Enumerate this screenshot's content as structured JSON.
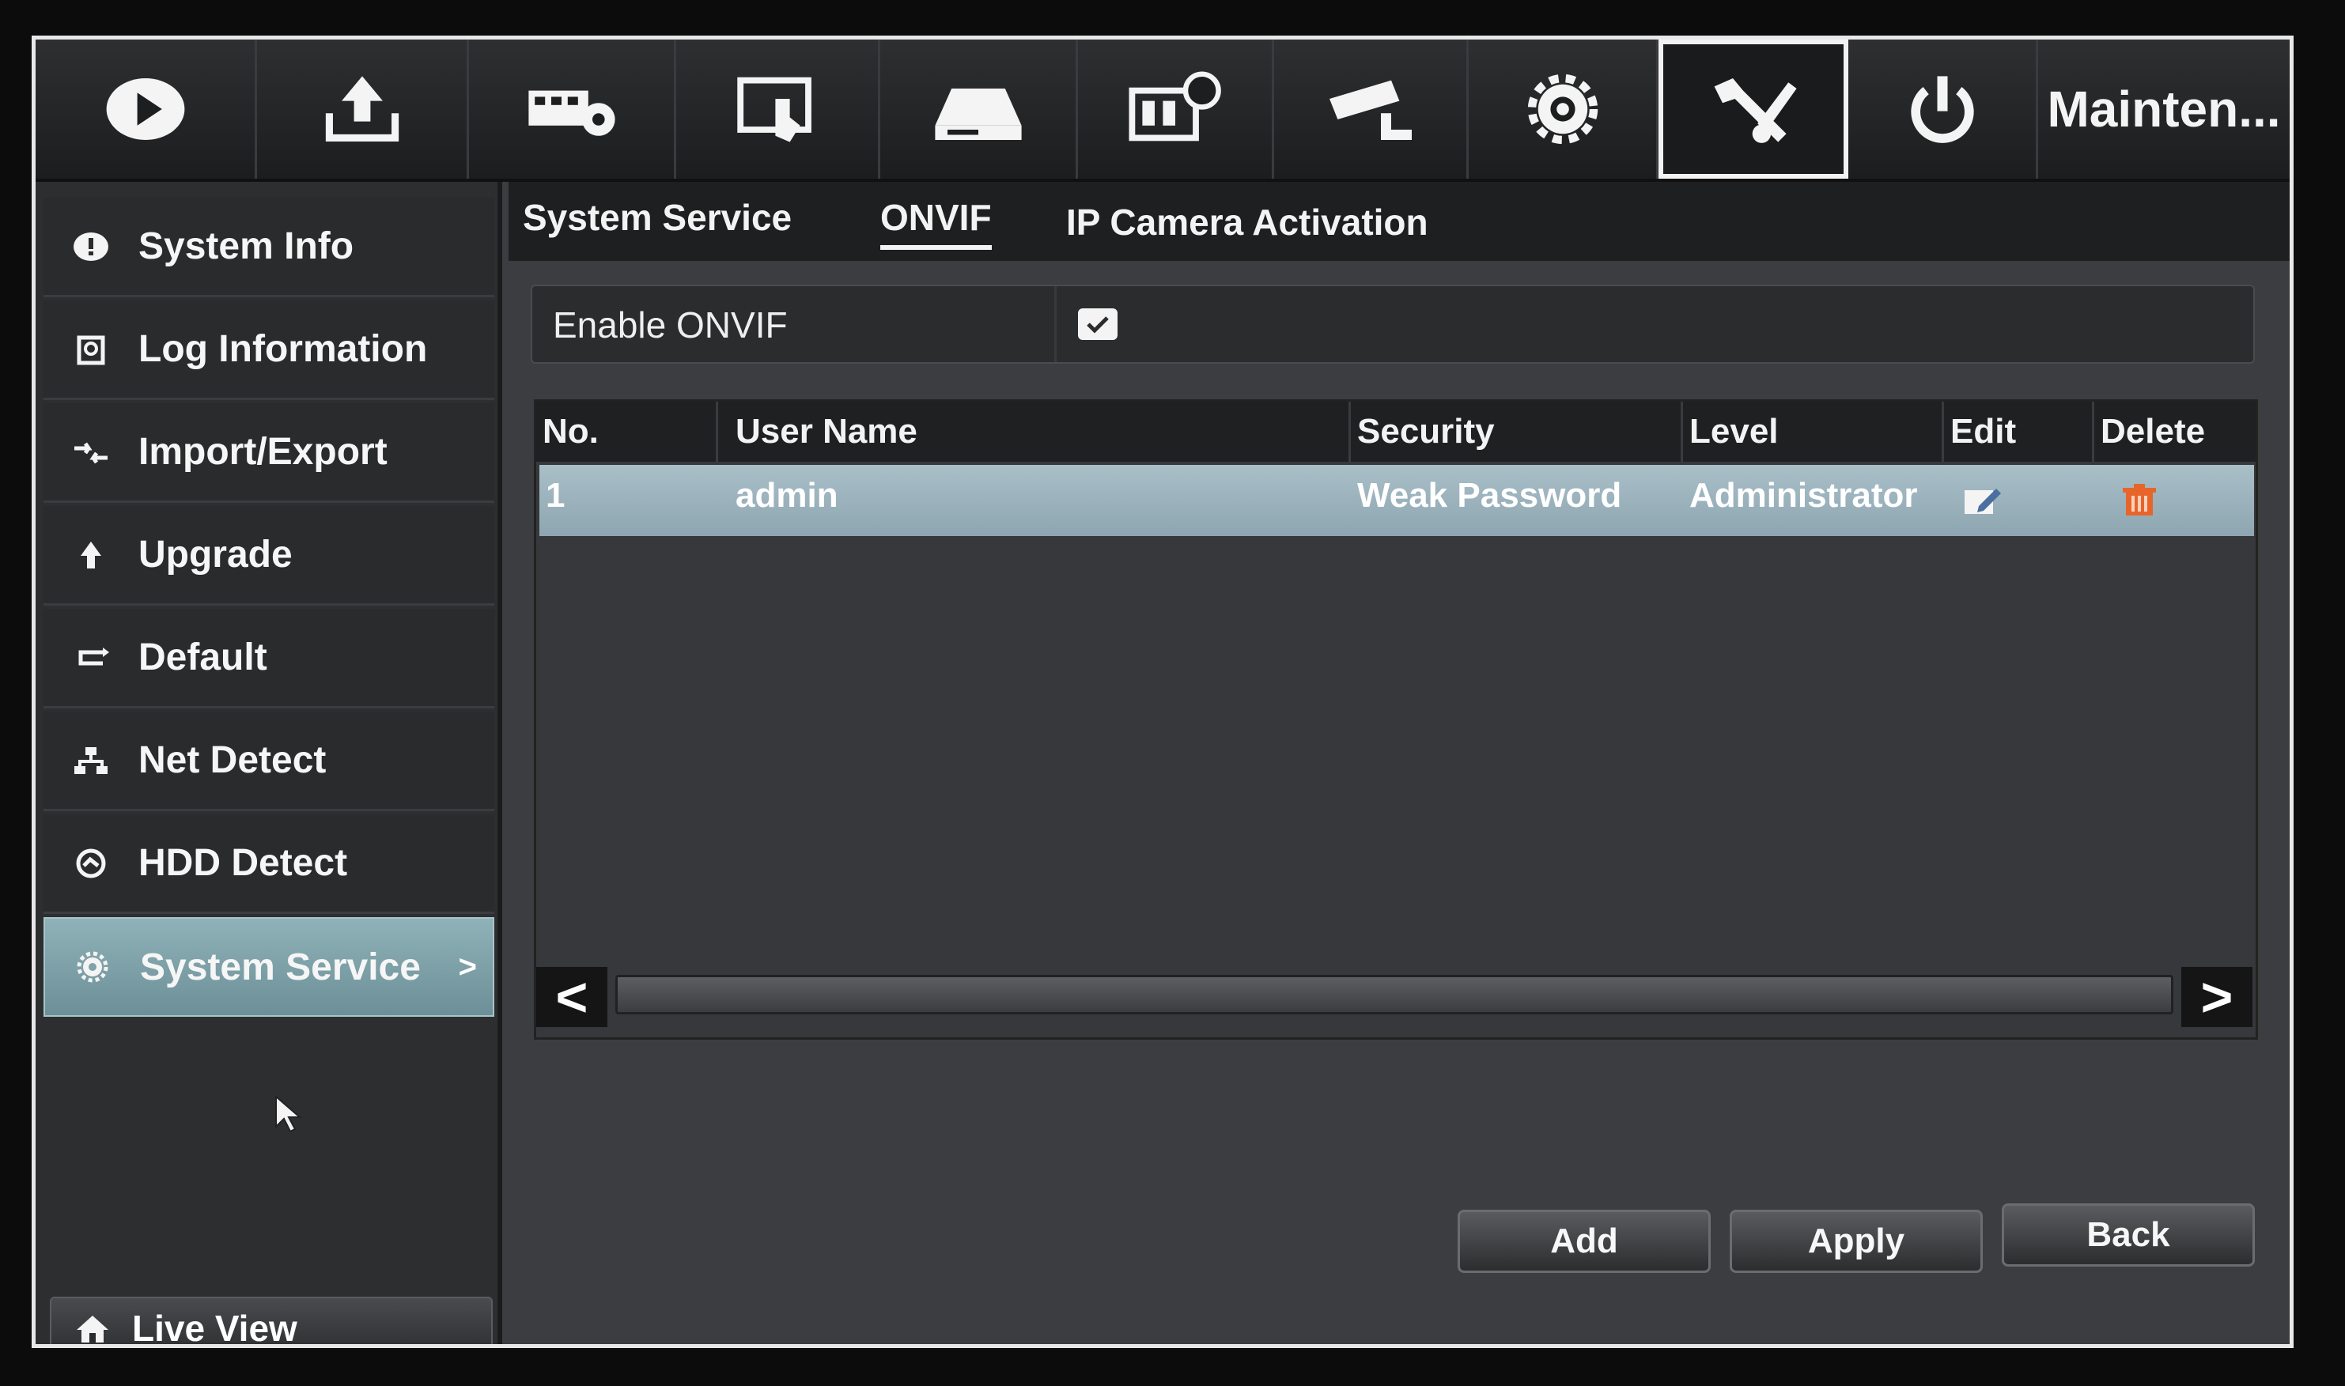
{
  "toolbar": {
    "icons": [
      "playback-icon",
      "export-icon",
      "record-settings-icon",
      "camera-touch-icon",
      "hdd-icon",
      "video-event-icon",
      "camera-icon",
      "settings-gear-icon",
      "maintenance-wrench-icon",
      "power-icon"
    ],
    "active_section": "Mainten..."
  },
  "sidebar": {
    "items": [
      {
        "label": "System Info",
        "icon": "info-icon"
      },
      {
        "label": "Log Information",
        "icon": "log-icon"
      },
      {
        "label": "Import/Export",
        "icon": "import-export-icon"
      },
      {
        "label": "Upgrade",
        "icon": "upgrade-icon"
      },
      {
        "label": "Default",
        "icon": "default-icon"
      },
      {
        "label": "Net Detect",
        "icon": "network-icon"
      },
      {
        "label": "HDD Detect",
        "icon": "hdd-detect-icon"
      },
      {
        "label": "System Service",
        "icon": "gear-icon",
        "arrow": ">"
      }
    ],
    "live_view": "Live View"
  },
  "tabs": [
    "System Service",
    "ONVIF",
    "IP Camera Activation"
  ],
  "onvif": {
    "enable_label": "Enable ONVIF",
    "enabled": true
  },
  "table": {
    "headers": [
      "No.",
      "User Name",
      "Security",
      "Level",
      "Edit",
      "Delete"
    ],
    "rows": [
      {
        "no": "1",
        "user": "admin",
        "security": "Weak Password",
        "level": "Administrator"
      }
    ],
    "scroll_left": "<",
    "scroll_right": ">"
  },
  "buttons": {
    "add": "Add",
    "apply": "Apply",
    "back": "Back"
  },
  "colors": {
    "selected_row": "#9fb6c0",
    "active_menu": "#7fa2aa",
    "delete_icon": "#e8652a"
  }
}
